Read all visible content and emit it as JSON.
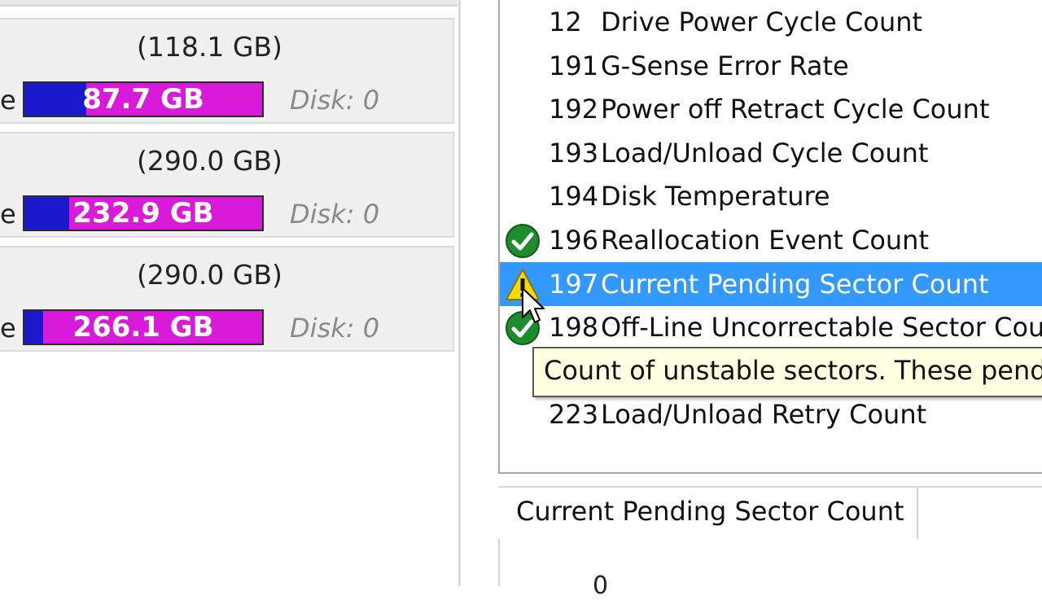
{
  "partitions": [
    {
      "size": "(118.1 GB)",
      "lead": "e",
      "free": "87.7 GB",
      "disk": "Disk: 0",
      "used_fraction": 0.26
    },
    {
      "size": "(290.0 GB)",
      "lead": "e",
      "free": "232.9 GB",
      "disk": "Disk: 0",
      "used_fraction": 0.19
    },
    {
      "size": "(290.0 GB)",
      "lead": "e",
      "free": "266.1 GB",
      "disk": "Disk: 0",
      "used_fraction": 0.08
    }
  ],
  "attributes": [
    {
      "id": "12",
      "name": "Drive Power Cycle Count",
      "status": ""
    },
    {
      "id": "191",
      "name": "G-Sense Error Rate",
      "status": ""
    },
    {
      "id": "192",
      "name": "Power off Retract Cycle Count",
      "status": ""
    },
    {
      "id": "193",
      "name": "Load/Unload Cycle Count",
      "status": ""
    },
    {
      "id": "194",
      "name": "Disk Temperature",
      "status": ""
    },
    {
      "id": "196",
      "name": "Reallocation Event Count",
      "status": "ok"
    },
    {
      "id": "197",
      "name": "Current Pending Sector Count",
      "status": "warning",
      "selected": true
    },
    {
      "id": "198",
      "name": "Off-Line Uncorrectable Sector Count",
      "status": "ok"
    },
    {
      "id": "223",
      "name": "Load/Unload Retry Count",
      "status": ""
    }
  ],
  "tooltip": "Count of unstable sectors. These pending",
  "detail": {
    "tab_label": "Current Pending Sector Count",
    "value": "0"
  },
  "colors": {
    "used": "#1a1acc",
    "free": "#d81bd8",
    "selection": "#3399ff",
    "ok": "#1e8c2c",
    "warning": "#f5d90a",
    "tooltip_bg": "#ffffe1"
  }
}
